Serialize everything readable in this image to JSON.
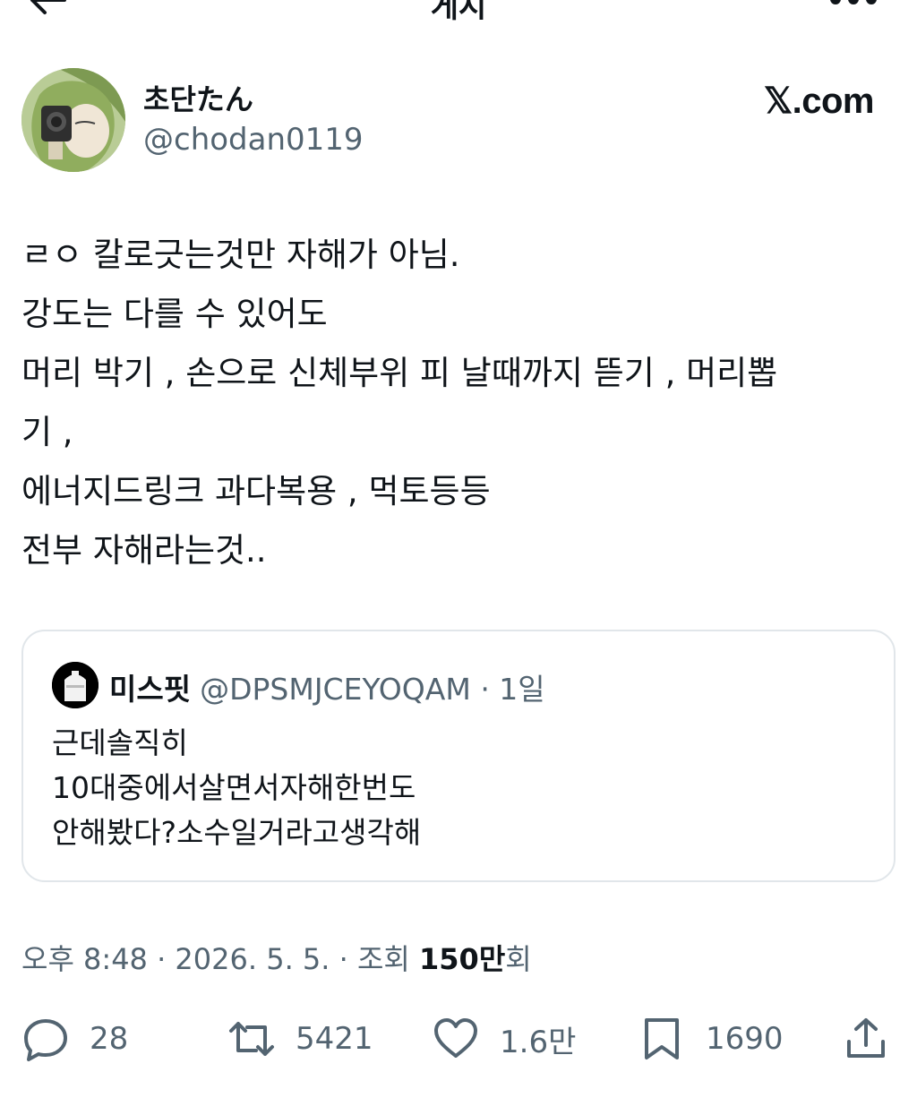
{
  "topbar": {
    "title": "게시"
  },
  "author": {
    "display_name": "초단たん",
    "handle": "@chodan0119",
    "site": "𝕏.com"
  },
  "tweet": {
    "lines": [
      "ㄹㅇ 칼로긋는것만 자해가 아님.",
      "강도는 다를 수 있어도",
      "머리 박기 , 손으로 신체부위 피 날때까지 뜯기 , 머리뽑",
      "기 ,",
      "에너지드링크 과다복용 , 먹토등등",
      "전부 자해라는것.."
    ]
  },
  "quote": {
    "name": "미스핏",
    "handle": "@DPSMJCEYOQAM",
    "time": "· 1일",
    "lines": [
      "근데솔직히",
      "10대중에서살면서자해한번도",
      "안해봤다?소수일거라고생각해"
    ]
  },
  "meta": {
    "time": "오후 8:48 · 2026. 5. 5. · 조회 ",
    "views": "150만",
    "views_suffix": "회"
  },
  "actions": {
    "replies": "28",
    "reposts": "5421",
    "likes": "1.6만",
    "bookmarks": "1690"
  },
  "colors": {
    "text": "#0f1419",
    "secondary": "#536471",
    "border": "#e1e6ea"
  }
}
